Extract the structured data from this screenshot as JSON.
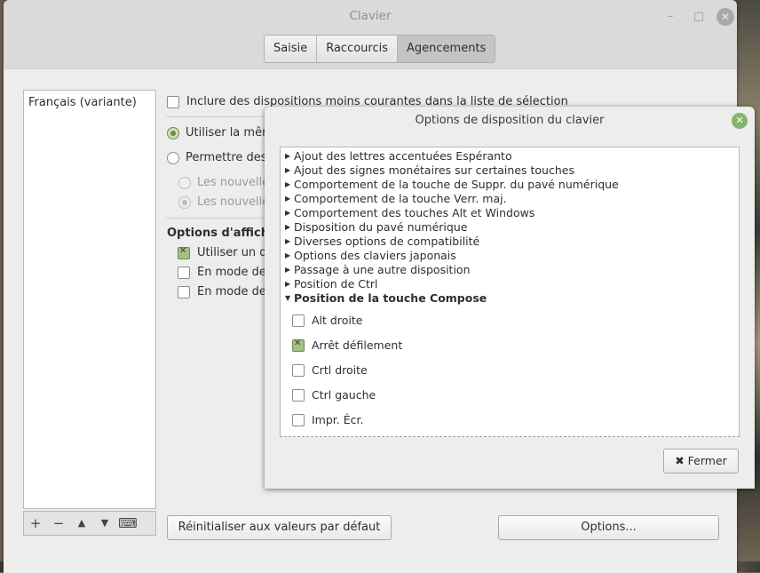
{
  "window": {
    "title": "Clavier",
    "min_glyph": "–",
    "max_glyph": "□",
    "close_glyph": "✕"
  },
  "tabs": [
    {
      "label": "Saisie",
      "active": false
    },
    {
      "label": "Raccourcis",
      "active": false
    },
    {
      "label": "Agencements",
      "active": true
    }
  ],
  "layouts": {
    "items": [
      "Français (variante)"
    ],
    "toolbar": {
      "add": "+",
      "remove": "−",
      "up": "▲",
      "down": "▼",
      "keyboard": "⌨"
    }
  },
  "options": {
    "include_less_common": {
      "label": "Inclure des dispositions moins courantes dans la liste de sélection",
      "checked": false
    },
    "radio_same": {
      "label": "Utiliser la mêm",
      "selected": true
    },
    "radio_allow": {
      "label": "Permettre des d",
      "selected": false
    },
    "sub_radio_1": {
      "label": "Les nouvelles",
      "selected": false
    },
    "sub_radio_2": {
      "label": "Les nouvelles",
      "selected": true
    },
    "display_section_title": "Options d'afficha",
    "display_1": {
      "label": "Utiliser un dr",
      "checked": true
    },
    "display_2": {
      "label": "En mode de r",
      "checked": false
    },
    "display_3": {
      "label": "En mode de r",
      "checked": false
    }
  },
  "buttons": {
    "reset": "Réinitialiser aux valeurs par défaut",
    "options": "Options..."
  },
  "dialog": {
    "title": "Options de disposition du clavier",
    "close_glyph": "✕",
    "tree": [
      "Ajout des lettres accentuées Espéranto",
      "Ajout des signes monétaires sur certaines touches",
      "Comportement de la touche de Suppr. du pavé numérique",
      "Comportement de la touche Verr. maj.",
      "Comportement des touches Alt et Windows",
      "Disposition du pavé numérique",
      "Diverses options de compatibilité",
      "Options des claviers japonais",
      "Passage à une autre disposition",
      "Position de Ctrl"
    ],
    "expanded": {
      "label": "Position de la touche Compose",
      "children": [
        {
          "label": "Alt droite",
          "checked": false
        },
        {
          "label": "Arrêt défilement",
          "checked": true
        },
        {
          "label": "Crtl droite",
          "checked": false
        },
        {
          "label": "Ctrl gauche",
          "checked": false
        },
        {
          "label": "Impr. Écr.",
          "checked": false
        }
      ]
    },
    "close_button": "Fermer",
    "close_button_icon": "✖"
  },
  "colors": {
    "accent": "#86b36a",
    "checked_fill": "#a7c088"
  }
}
